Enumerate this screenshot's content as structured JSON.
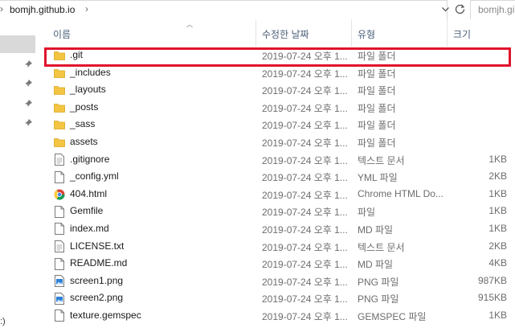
{
  "address": {
    "path": "bomjh.github.io",
    "search_placeholder": "bomjh.gi"
  },
  "columns": {
    "name": "이름",
    "date": "수정한 날짜",
    "type": "유형",
    "size": "크기"
  },
  "nav": {
    "fragment": ":)"
  },
  "files": [
    {
      "name": ".git",
      "date": "2019-07-24 오후 1...",
      "type": "파일 폴더",
      "size": "",
      "icon": "folder-icon"
    },
    {
      "name": "_includes",
      "date": "2019-07-24 오후 1...",
      "type": "파일 폴더",
      "size": "",
      "icon": "folder-icon"
    },
    {
      "name": "_layouts",
      "date": "2019-07-24 오후 1...",
      "type": "파일 폴더",
      "size": "",
      "icon": "folder-icon"
    },
    {
      "name": "_posts",
      "date": "2019-07-24 오후 1...",
      "type": "파일 폴더",
      "size": "",
      "icon": "folder-icon"
    },
    {
      "name": "_sass",
      "date": "2019-07-24 오후 1...",
      "type": "파일 폴더",
      "size": "",
      "icon": "folder-icon"
    },
    {
      "name": "assets",
      "date": "2019-07-24 오후 1...",
      "type": "파일 폴더",
      "size": "",
      "icon": "folder-icon"
    },
    {
      "name": ".gitignore",
      "date": "2019-07-24 오후 1...",
      "type": "텍스트 문서",
      "size": "1KB",
      "icon": "text-file-icon"
    },
    {
      "name": "_config.yml",
      "date": "2019-07-24 오후 1...",
      "type": "YML 파일",
      "size": "2KB",
      "icon": "file-icon"
    },
    {
      "name": "404.html",
      "date": "2019-07-24 오후 1...",
      "type": "Chrome HTML Do...",
      "size": "1KB",
      "icon": "chrome-icon"
    },
    {
      "name": "Gemfile",
      "date": "2019-07-24 오후 1...",
      "type": "파일",
      "size": "1KB",
      "icon": "file-icon"
    },
    {
      "name": "index.md",
      "date": "2019-07-24 오후 1...",
      "type": "MD 파일",
      "size": "1KB",
      "icon": "file-icon"
    },
    {
      "name": "LICENSE.txt",
      "date": "2019-07-24 오후 1...",
      "type": "텍스트 문서",
      "size": "2KB",
      "icon": "text-file-icon"
    },
    {
      "name": "README.md",
      "date": "2019-07-24 오후 1...",
      "type": "MD 파일",
      "size": "4KB",
      "icon": "file-icon"
    },
    {
      "name": "screen1.png",
      "date": "2019-07-24 오후 1...",
      "type": "PNG 파일",
      "size": "987KB",
      "icon": "image-file-icon"
    },
    {
      "name": "screen2.png",
      "date": "2019-07-24 오후 1...",
      "type": "PNG 파일",
      "size": "915KB",
      "icon": "image-file-icon"
    },
    {
      "name": "texture.gemspec",
      "date": "2019-07-24 오후 1...",
      "type": "GEMSPEC 파일",
      "size": "1KB",
      "icon": "file-icon"
    }
  ],
  "highlight_color": "#e0142c",
  "folder_color": "#f4c542"
}
